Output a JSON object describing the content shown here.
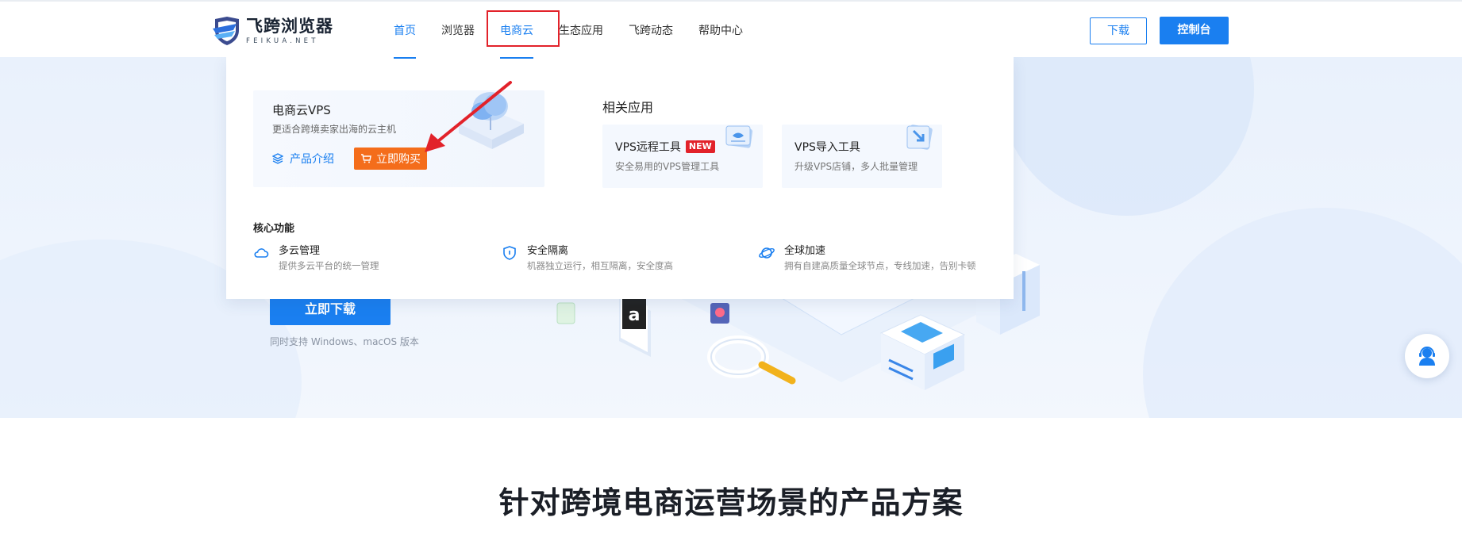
{
  "brand": {
    "name_cn": "飞跨浏览器",
    "name_en": "FEIKUA.NET"
  },
  "nav": {
    "items": [
      {
        "label": "首页",
        "state": "active"
      },
      {
        "label": "浏览器",
        "state": ""
      },
      {
        "label": "电商云",
        "state": "hover"
      },
      {
        "label": "生态应用",
        "state": ""
      },
      {
        "label": "飞跨动态",
        "state": ""
      },
      {
        "label": "帮助中心",
        "state": ""
      }
    ],
    "download_label": "下载",
    "console_label": "控制台"
  },
  "dropdown": {
    "vps": {
      "title": "电商云VPS",
      "desc": "更适合跨境卖家出海的云主机",
      "intro_label": "产品介绍",
      "buy_label": "立即购买"
    },
    "related": {
      "title": "相关应用",
      "apps": [
        {
          "title": "VPS远程工具",
          "badge": "NEW",
          "desc": "安全易用的VPS管理工具"
        },
        {
          "title": "VPS导入工具",
          "badge": "",
          "desc": "升级VPS店铺，多人批量管理"
        }
      ]
    },
    "core": {
      "title": "核心功能",
      "features": [
        {
          "title": "多云管理",
          "desc": "提供多云平台的统一管理",
          "icon": "cloud-icon"
        },
        {
          "title": "安全隔离",
          "desc": "机器独立运行，相互隔离，安全度高",
          "icon": "shield-icon"
        },
        {
          "title": "全球加速",
          "desc": "拥有自建高质量全球节点，专线加速，告别卡顿",
          "icon": "globe-icon"
        }
      ]
    }
  },
  "hero": {
    "download_label": "立即下载",
    "note": "同时支持 Windows、macOS 版本"
  },
  "section": {
    "title": "针对跨境电商运营场景的产品方案"
  },
  "colors": {
    "primary": "#1a7ff0",
    "buy": "#f46d1b",
    "badge": "#e2222a",
    "annotation": "#e2222a"
  }
}
